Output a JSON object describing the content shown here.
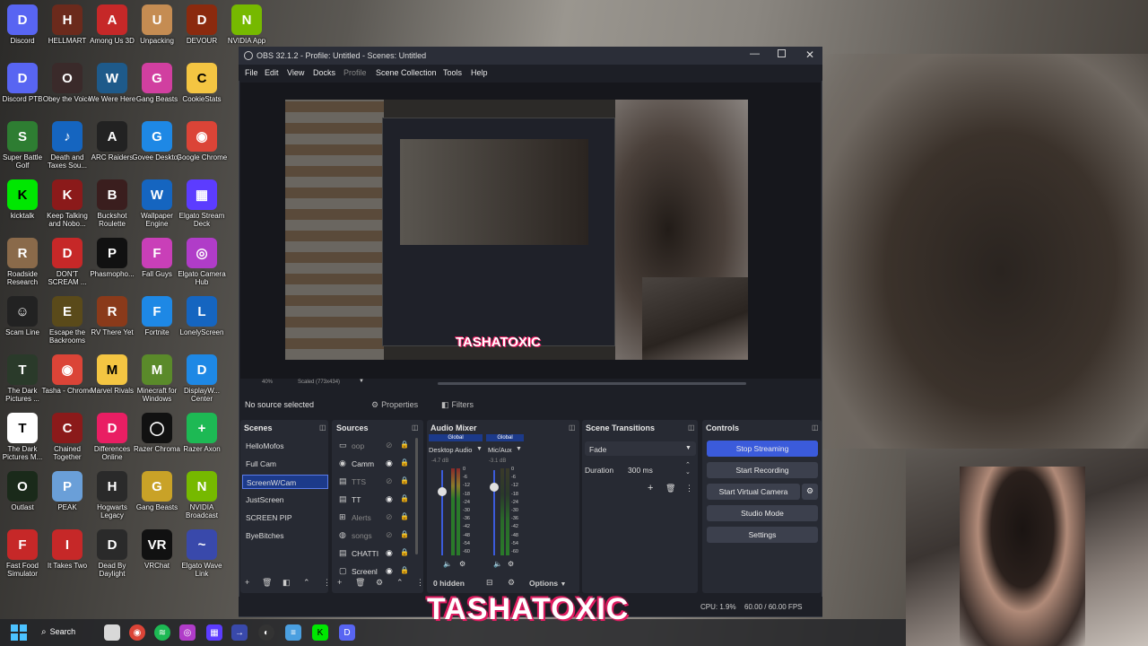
{
  "desktop": {
    "icons": [
      {
        "label": "Discord",
        "color": "#5865f2",
        "glyph": "D",
        "icon": "discord-icon"
      },
      {
        "label": "HELLMART",
        "color": "#6b2a1c",
        "glyph": "H",
        "icon": "hellmart-icon"
      },
      {
        "label": "Among Us 3D",
        "color": "#c62828",
        "glyph": "A",
        "icon": "among-us-icon"
      },
      {
        "label": "Unpacking",
        "color": "#c58c52",
        "glyph": "U",
        "icon": "unpacking-icon"
      },
      {
        "label": "DEVOUR",
        "color": "#8b2a0e",
        "glyph": "D",
        "icon": "devour-icon"
      },
      {
        "label": "NVIDIA App",
        "color": "#76b900",
        "glyph": "N",
        "icon": "nvidia-icon"
      },
      {
        "label": "Discord PTB",
        "color": "#5865f2",
        "glyph": "D",
        "icon": "discord-ptb-icon"
      },
      {
        "label": "Obey the Voice",
        "color": "#3a2a2a",
        "glyph": "O",
        "icon": "obey-voice-icon"
      },
      {
        "label": "We Were Here",
        "color": "#1e5a8a",
        "glyph": "W",
        "icon": "we-were-here-icon"
      },
      {
        "label": "Gang Beasts",
        "color": "#d13fa0",
        "glyph": "G",
        "icon": "gang-beasts-icon"
      },
      {
        "label": "CookieStats",
        "color": "#f4c542",
        "glyph": "C",
        "icon": "folder-icon"
      },
      {
        "label": "Super Battle Golf",
        "color": "#2e7d32",
        "glyph": "S",
        "icon": "super-battle-golf-icon"
      },
      {
        "label": "Death and Taxes Sou...",
        "color": "#1565c0",
        "glyph": "♪",
        "icon": "music-icon"
      },
      {
        "label": "ARC Raiders",
        "color": "#222",
        "glyph": "A",
        "icon": "arc-raiders-icon"
      },
      {
        "label": "Govee Desktop",
        "color": "#1e88e5",
        "glyph": "G",
        "icon": "govee-icon"
      },
      {
        "label": "Google Chrome",
        "color": "#db4437",
        "glyph": "◉",
        "icon": "chrome-icon"
      },
      {
        "label": "kicktalk",
        "color": "#00e701",
        "glyph": "K",
        "icon": "kicktalk-icon"
      },
      {
        "label": "Keep Talking and Nobo...",
        "color": "#8b1a1a",
        "glyph": "K",
        "icon": "keep-talking-icon"
      },
      {
        "label": "Buckshot Roulette",
        "color": "#3a1e1e",
        "glyph": "B",
        "icon": "buckshot-icon"
      },
      {
        "label": "Wallpaper Engine",
        "color": "#1565c0",
        "glyph": "W",
        "icon": "wallpaper-engine-icon"
      },
      {
        "label": "Elgato Stream Deck",
        "color": "#5c3cff",
        "glyph": "▦",
        "icon": "stream-deck-icon"
      },
      {
        "label": "Roadside Research",
        "color": "#8a6a4a",
        "glyph": "R",
        "icon": "roadside-icon"
      },
      {
        "label": "DON'T SCREAM ...",
        "color": "#c62828",
        "glyph": "D",
        "icon": "dont-scream-icon"
      },
      {
        "label": "Phasmopho...",
        "color": "#111",
        "glyph": "P",
        "icon": "phasmophobia-icon"
      },
      {
        "label": "Fall Guys",
        "color": "#c93fb8",
        "glyph": "F",
        "icon": "fall-guys-icon"
      },
      {
        "label": "Elgato Camera Hub",
        "color": "#b03cc8",
        "glyph": "◎",
        "icon": "camera-hub-icon"
      },
      {
        "label": "Scam Line",
        "color": "#222",
        "glyph": "☺",
        "icon": "scam-line-icon"
      },
      {
        "label": "Escape the Backrooms",
        "color": "#5a4a1a",
        "glyph": "E",
        "icon": "backrooms-icon"
      },
      {
        "label": "RV There Yet",
        "color": "#8a3a1a",
        "glyph": "R",
        "icon": "rv-there-yet-icon"
      },
      {
        "label": "Fortnite",
        "color": "#1e88e5",
        "glyph": "F",
        "icon": "fortnite-icon"
      },
      {
        "label": "LonelyScreen",
        "color": "#1565c0",
        "glyph": "L",
        "icon": "lonelyscreen-icon"
      },
      {
        "label": "The Dark Pictures ...",
        "color": "#2a3a2a",
        "glyph": "T",
        "icon": "dark-pictures-icon"
      },
      {
        "label": "Tasha - Chrome",
        "color": "#db4437",
        "glyph": "◉",
        "icon": "chrome-icon"
      },
      {
        "label": "Marvel Rivals",
        "color": "#f4c542",
        "glyph": "M",
        "icon": "marvel-rivals-icon"
      },
      {
        "label": "Minecraft for Windows",
        "color": "#5a8a2a",
        "glyph": "M",
        "icon": "minecraft-icon"
      },
      {
        "label": "DisplayW... Center",
        "color": "#1e88e5",
        "glyph": "D",
        "icon": "display-center-icon"
      },
      {
        "label": "The Dark Pictures M...",
        "color": "#ffffff",
        "glyph": "T",
        "icon": "file-icon"
      },
      {
        "label": "Chained Together",
        "color": "#8b1a1a",
        "glyph": "C",
        "icon": "chained-together-icon"
      },
      {
        "label": "Differences Online",
        "color": "#e91e63",
        "glyph": "D",
        "icon": "differences-icon"
      },
      {
        "label": "Razer Chroma",
        "color": "#111",
        "glyph": "◯",
        "icon": "razer-chroma-icon"
      },
      {
        "label": "Razer Axon",
        "color": "#1db954",
        "glyph": "+",
        "icon": "razer-axon-icon"
      },
      {
        "label": "Outlast",
        "color": "#1a2a1a",
        "glyph": "O",
        "icon": "outlast-icon"
      },
      {
        "label": "PEAK",
        "color": "#6a9fd8",
        "glyph": "P",
        "icon": "peak-icon"
      },
      {
        "label": "Hogwarts Legacy",
        "color": "#2a2a2a",
        "glyph": "H",
        "icon": "hogwarts-icon"
      },
      {
        "label": "Gang Beasts",
        "color": "#c9a227",
        "glyph": "G",
        "icon": "gang-beasts-icon"
      },
      {
        "label": "NVIDIA Broadcast",
        "color": "#76b900",
        "glyph": "N",
        "icon": "nvidia-broadcast-icon"
      },
      {
        "label": "Fast Food Simulator",
        "color": "#c62828",
        "glyph": "F",
        "icon": "fast-food-icon"
      },
      {
        "label": "It Takes Two",
        "color": "#c62828",
        "glyph": "I",
        "icon": "it-takes-two-icon"
      },
      {
        "label": "Dead By Daylight",
        "color": "#2a2a2a",
        "glyph": "D",
        "icon": "dead-by-daylight-icon"
      },
      {
        "label": "VRChat",
        "color": "#111",
        "glyph": "VR",
        "icon": "vrchat-icon"
      },
      {
        "label": "Elgato Wave Link",
        "color": "#3949ab",
        "glyph": "~",
        "icon": "wave-link-icon"
      }
    ]
  },
  "taskbar": {
    "search_label": "Search"
  },
  "obs": {
    "title": "OBS 32.1.2 - Profile: Untitled - Scenes: Untitled",
    "menu": [
      "File",
      "Edit",
      "View",
      "Docks",
      "Profile",
      "Scene Collection",
      "Tools",
      "Help"
    ],
    "preview": {
      "zoom": "40%",
      "scale_label": "Scaled (773x434)",
      "overlay_name": "TASHATOXIC"
    },
    "source_bar": {
      "no_source": "No source selected",
      "properties": "Properties",
      "filters": "Filters"
    },
    "scenes": {
      "title": "Scenes",
      "items": [
        "HelloMofos",
        "Full Cam",
        "ScreenW/Cam",
        "JustScreen",
        "SCREEN PIP",
        "ByeBitches"
      ],
      "selected_index": 2
    },
    "sources": {
      "title": "Sources",
      "items": [
        {
          "name": "oop",
          "visible": false
        },
        {
          "name": "Camm",
          "visible": true
        },
        {
          "name": "TTS",
          "visible": false
        },
        {
          "name": "TT",
          "visible": true
        },
        {
          "name": "Alerts",
          "visible": false
        },
        {
          "name": "songs",
          "visible": false
        },
        {
          "name": "CHATTII",
          "visible": true
        },
        {
          "name": "Screenl",
          "visible": true
        }
      ]
    },
    "mixer": {
      "title": "Audio Mixer",
      "channels": [
        {
          "badge": "Global",
          "name": "Desktop Audio",
          "db": "-4.7 dB"
        },
        {
          "badge": "Global",
          "name": "Mic/Aux",
          "db": "-3.1 dB"
        }
      ],
      "scale": [
        "0",
        "-6",
        "-12",
        "-18",
        "-24",
        "-30",
        "-36",
        "-42",
        "-48",
        "-54",
        "-60"
      ],
      "hidden": "0 hidden",
      "options": "Options"
    },
    "transitions": {
      "title": "Scene Transitions",
      "selected": "Fade",
      "duration_label": "Duration",
      "duration_value": "300 ms"
    },
    "controls": {
      "title": "Controls",
      "stop_streaming": "Stop Streaming",
      "start_recording": "Start Recording",
      "start_virtual_camera": "Start Virtual Camera",
      "studio_mode": "Studio Mode",
      "settings": "Settings"
    },
    "status": {
      "cpu": "CPU: 1.9%",
      "fps": "60.00 / 60.00 FPS"
    },
    "accent": "#3b5bdb"
  },
  "overlay": {
    "name": "TASHATOXIC"
  }
}
